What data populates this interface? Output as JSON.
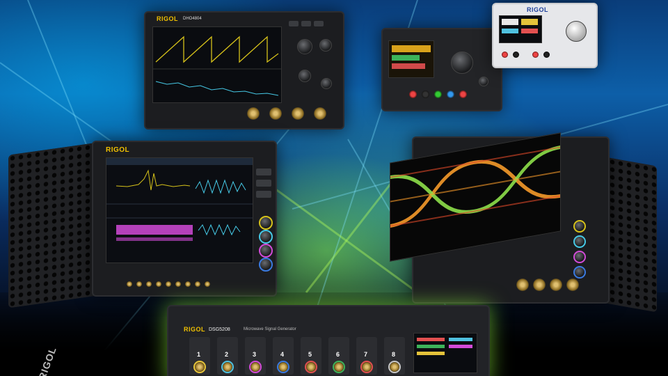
{
  "brand": {
    "name": "RIGOL"
  },
  "scope_top": {
    "model": "DHO4804"
  },
  "signal_generator": {
    "model": "DSG5208",
    "subtitle": "Microwave Signal Generator",
    "channels": [
      "1",
      "2",
      "3",
      "4",
      "5",
      "6",
      "7",
      "8"
    ]
  },
  "colors": {
    "brand_yellow": "#f0c000",
    "eye_green": "#8ee04a",
    "eye_orange": "#f59a2a",
    "waveform_yellow": "#d6c21a",
    "waveform_cyan": "#46c9e6",
    "waveform_magenta": "#d24bd8"
  }
}
